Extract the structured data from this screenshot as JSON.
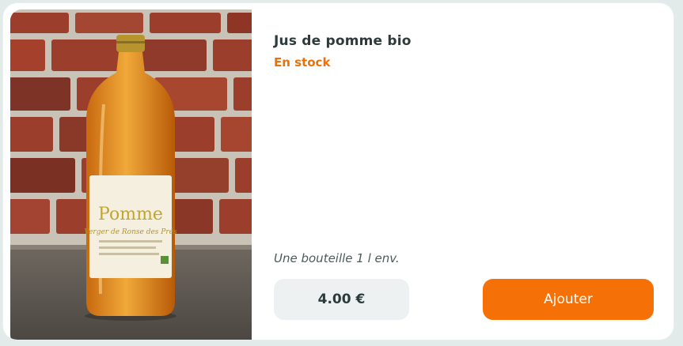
{
  "product": {
    "name": "Jus de pomme bio",
    "availability": "En stock",
    "description": "Une bouteille 1 l env.",
    "price": "4.00 €",
    "add_label": "Ajouter",
    "image_alt": "Bouteille de jus de pomme"
  },
  "label": {
    "brand": "Pomme",
    "subtitle": "Verger de Ronse des Prés"
  },
  "colors": {
    "accent": "#f57107",
    "stock": "#f07004",
    "text": "#2d3a3a",
    "price_bg": "#edf1f1"
  }
}
